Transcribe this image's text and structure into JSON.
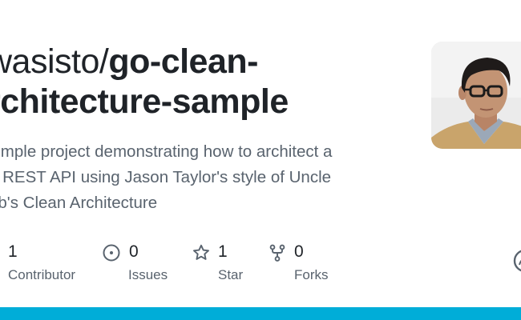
{
  "repo": {
    "owner": "wasisto/",
    "name": "go-clean-architecture-sample",
    "name_line1": "go-clean-",
    "name_line2": "rchitecture-sample",
    "description": "simple project demonstrating how to architect a o REST API using Jason Taylor's style of Uncle ob's Clean Architecture",
    "description_lines": [
      "simple project demonstrating how to architect a",
      "o REST API using Jason Taylor's style of Uncle",
      "ob's Clean Architecture"
    ]
  },
  "stats": {
    "contributors": {
      "count": "1",
      "label": "Contributor",
      "icon": "people-icon"
    },
    "issues": {
      "count": "0",
      "label": "Issues",
      "icon": "issue-opened-icon"
    },
    "stars": {
      "count": "1",
      "label": "Star",
      "icon": "star-icon"
    },
    "forks": {
      "count": "0",
      "label": "Forks",
      "icon": "repo-forked-icon"
    }
  },
  "colors": {
    "title": "#1f2328",
    "muted": "#59636e",
    "icon": "#59636e",
    "bottom_bar": "#00add8"
  }
}
